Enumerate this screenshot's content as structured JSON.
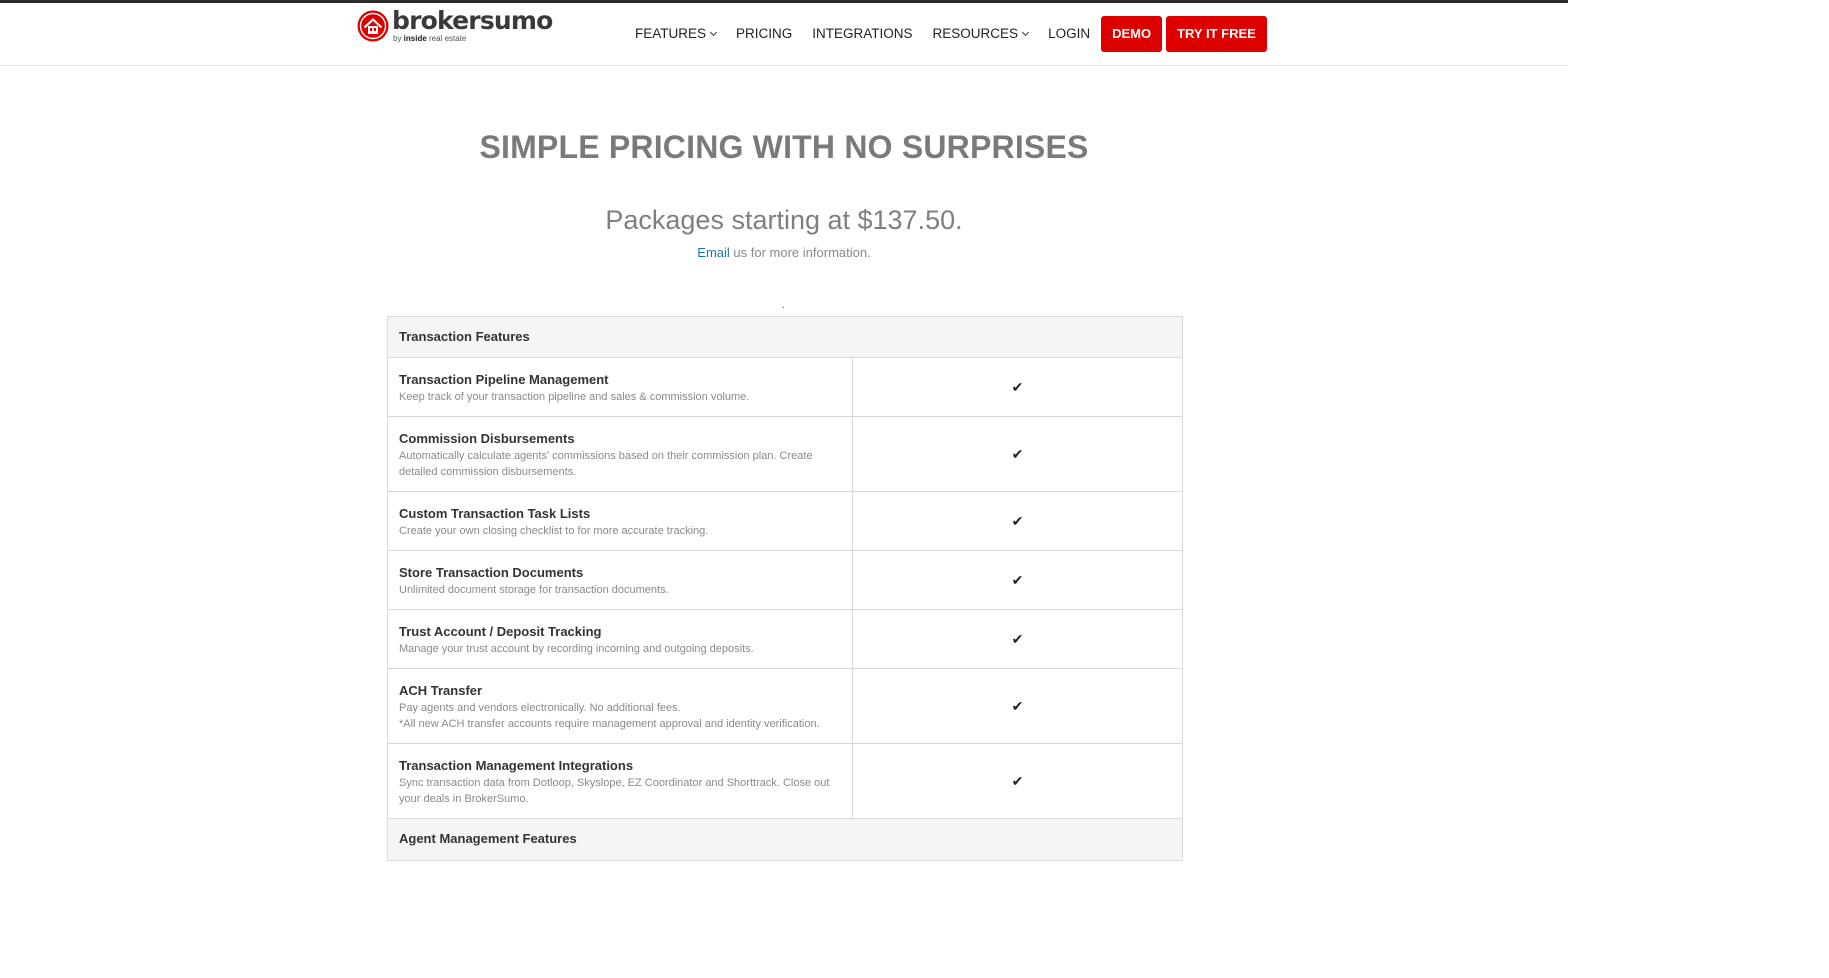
{
  "header": {
    "brand": "brokersumo",
    "byline_prefix": "by ",
    "byline_brand": "inside",
    "byline_suffix": " real estate",
    "nav": {
      "features": "FEATURES",
      "pricing": "PRICING",
      "integrations": "INTEGRATIONS",
      "resources": "RESOURCES",
      "login": "LOGIN"
    },
    "demo_button": "DEMO",
    "try_button": "TRY IT FREE"
  },
  "hero": {
    "title": "SIMPLE PRICING WITH NO SURPRISES",
    "subtitle": "Packages starting at $137.50.",
    "email_link": "Email",
    "email_rest": " us for more information."
  },
  "table": {
    "sections": [
      {
        "title": "Transaction Features",
        "rows": [
          {
            "title": "Transaction Pipeline Management",
            "desc": [
              "Keep track of your transaction pipeline and sales & commission volume."
            ],
            "included": true
          },
          {
            "title": "Commission Disbursements",
            "desc": [
              "Automatically calculate agents' commissions based on their commission plan. Create detailed commission disbursements."
            ],
            "included": true
          },
          {
            "title": "Custom Transaction Task Lists",
            "desc": [
              "Create your own closing checklist to for more accurate tracking."
            ],
            "included": true
          },
          {
            "title": "Store Transaction Documents",
            "desc": [
              "Unlimited document storage for transaction documents."
            ],
            "included": true
          },
          {
            "title": "Trust Account / Deposit Tracking",
            "desc": [
              "Manage your trust account by recording incoming and outgoing deposits."
            ],
            "included": true
          },
          {
            "title": "ACH Transfer",
            "desc": [
              "Pay agents and vendors electronically. No additional fees.",
              "*All new ACH transfer accounts require management approval and identity verification."
            ],
            "included": true
          },
          {
            "title": "Transaction Management Integrations",
            "desc": [
              "Sync transaction data from Dotloop, Skyslope, EZ Coordinator and Shorttrack. Close out your deals in BrokerSumo."
            ],
            "included": true
          }
        ]
      },
      {
        "title": "Agent Management Features"
      }
    ],
    "check_glyph": "✔"
  },
  "colors": {
    "accent": "#dd0000",
    "link": "#1a73b8"
  }
}
